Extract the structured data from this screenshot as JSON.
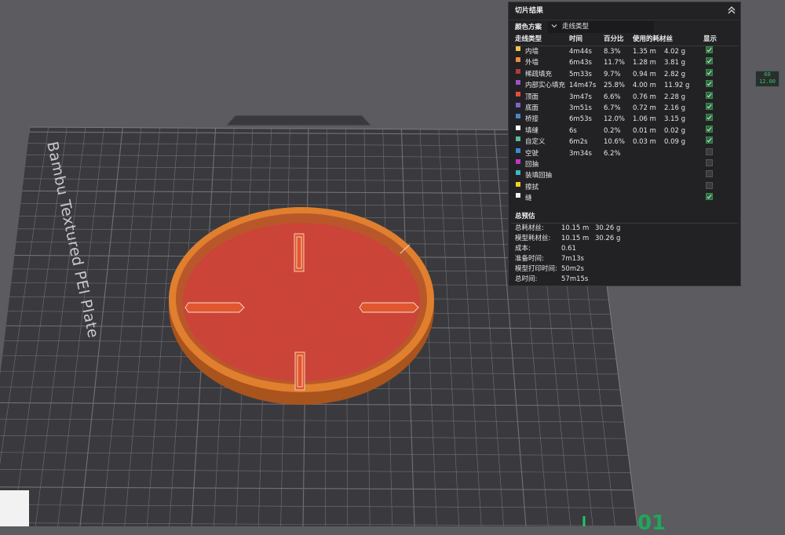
{
  "plate": {
    "label": "Bambu Textured PEI Plate"
  },
  "panel": {
    "title": "切片结果",
    "color_scheme_label": "颜色方案",
    "color_scheme_value": "走线类型",
    "headers": {
      "type": "走线类型",
      "time": "时间",
      "percent": "百分比",
      "filament": "使用的耗材丝",
      "display": "显示"
    },
    "rows": [
      {
        "name": "内墙",
        "color": "#f2c24a",
        "time": "4m44s",
        "percent": "8.3%",
        "length": "1.35 m",
        "weight": "4.02 g",
        "shown": true
      },
      {
        "name": "外墙",
        "color": "#f08a3e",
        "time": "6m43s",
        "percent": "11.7%",
        "length": "1.28 m",
        "weight": "3.81 g",
        "shown": true
      },
      {
        "name": "稀疏填充",
        "color": "#b23a3e",
        "time": "5m33s",
        "percent": "9.7%",
        "length": "0.94 m",
        "weight": "2.82 g",
        "shown": true
      },
      {
        "name": "内部实心填充",
        "color": "#9a52c8",
        "time": "14m47s",
        "percent": "25.8%",
        "length": "4.00 m",
        "weight": "11.92 g",
        "shown": true
      },
      {
        "name": "顶面",
        "color": "#e84a3c",
        "time": "3m47s",
        "percent": "6.6%",
        "length": "0.76 m",
        "weight": "2.28 g",
        "shown": true
      },
      {
        "name": "底面",
        "color": "#7a66c8",
        "time": "3m51s",
        "percent": "6.7%",
        "length": "0.72 m",
        "weight": "2.16 g",
        "shown": true
      },
      {
        "name": "桥接",
        "color": "#4a86c8",
        "time": "6m53s",
        "percent": "12.0%",
        "length": "1.06 m",
        "weight": "3.15 g",
        "shown": true
      },
      {
        "name": "填缝",
        "color": "#ffffff",
        "time": "6s",
        "percent": "0.2%",
        "length": "0.01 m",
        "weight": "0.02 g",
        "shown": true
      },
      {
        "name": "自定义",
        "color": "#5fb89a",
        "time": "6m2s",
        "percent": "10.6%",
        "length": "0.03 m",
        "weight": "0.09 g",
        "shown": true
      },
      {
        "name": "空驶",
        "color": "#3a8ad0",
        "time": "3m34s",
        "percent": "6.2%",
        "length": "",
        "weight": "",
        "shown": false
      },
      {
        "name": "回抽",
        "color": "#c236c2",
        "time": "",
        "percent": "",
        "length": "",
        "weight": "",
        "shown": false
      },
      {
        "name": "装填回抽",
        "color": "#3ab8c8",
        "time": "",
        "percent": "",
        "length": "",
        "weight": "",
        "shown": false
      },
      {
        "name": "擦拭",
        "color": "#f2d21e",
        "time": "",
        "percent": "",
        "length": "",
        "weight": "",
        "shown": false
      },
      {
        "name": "缝",
        "color": "#f0f0f0",
        "time": "",
        "percent": "",
        "length": "",
        "weight": "",
        "shown": true
      }
    ],
    "estimate": {
      "title": "总预估",
      "rows": [
        {
          "label": "总耗材丝:",
          "value": "10.15 m",
          "value2": "30.26 g"
        },
        {
          "label": "模型耗材丝:",
          "value": "10.15 m",
          "value2": "30.26 g"
        },
        {
          "label": "成本:",
          "value": "0.61",
          "value2": ""
        },
        {
          "label": "准备时间:",
          "value": "7m13s",
          "value2": ""
        },
        {
          "label": "模型打印时间:",
          "value": "50m2s",
          "value2": ""
        },
        {
          "label": "总时间:",
          "value": "57m15s",
          "value2": ""
        }
      ]
    }
  },
  "layer_badge": {
    "top": "60",
    "bottom": "12.00"
  },
  "bottom_number": "01",
  "colors": {
    "background": "#5b5b60",
    "plate": "#3a3a3e",
    "grid": "#6e6e74",
    "rim": "#d8762a",
    "floor": "#d3473b",
    "accent": "#27c46b"
  }
}
